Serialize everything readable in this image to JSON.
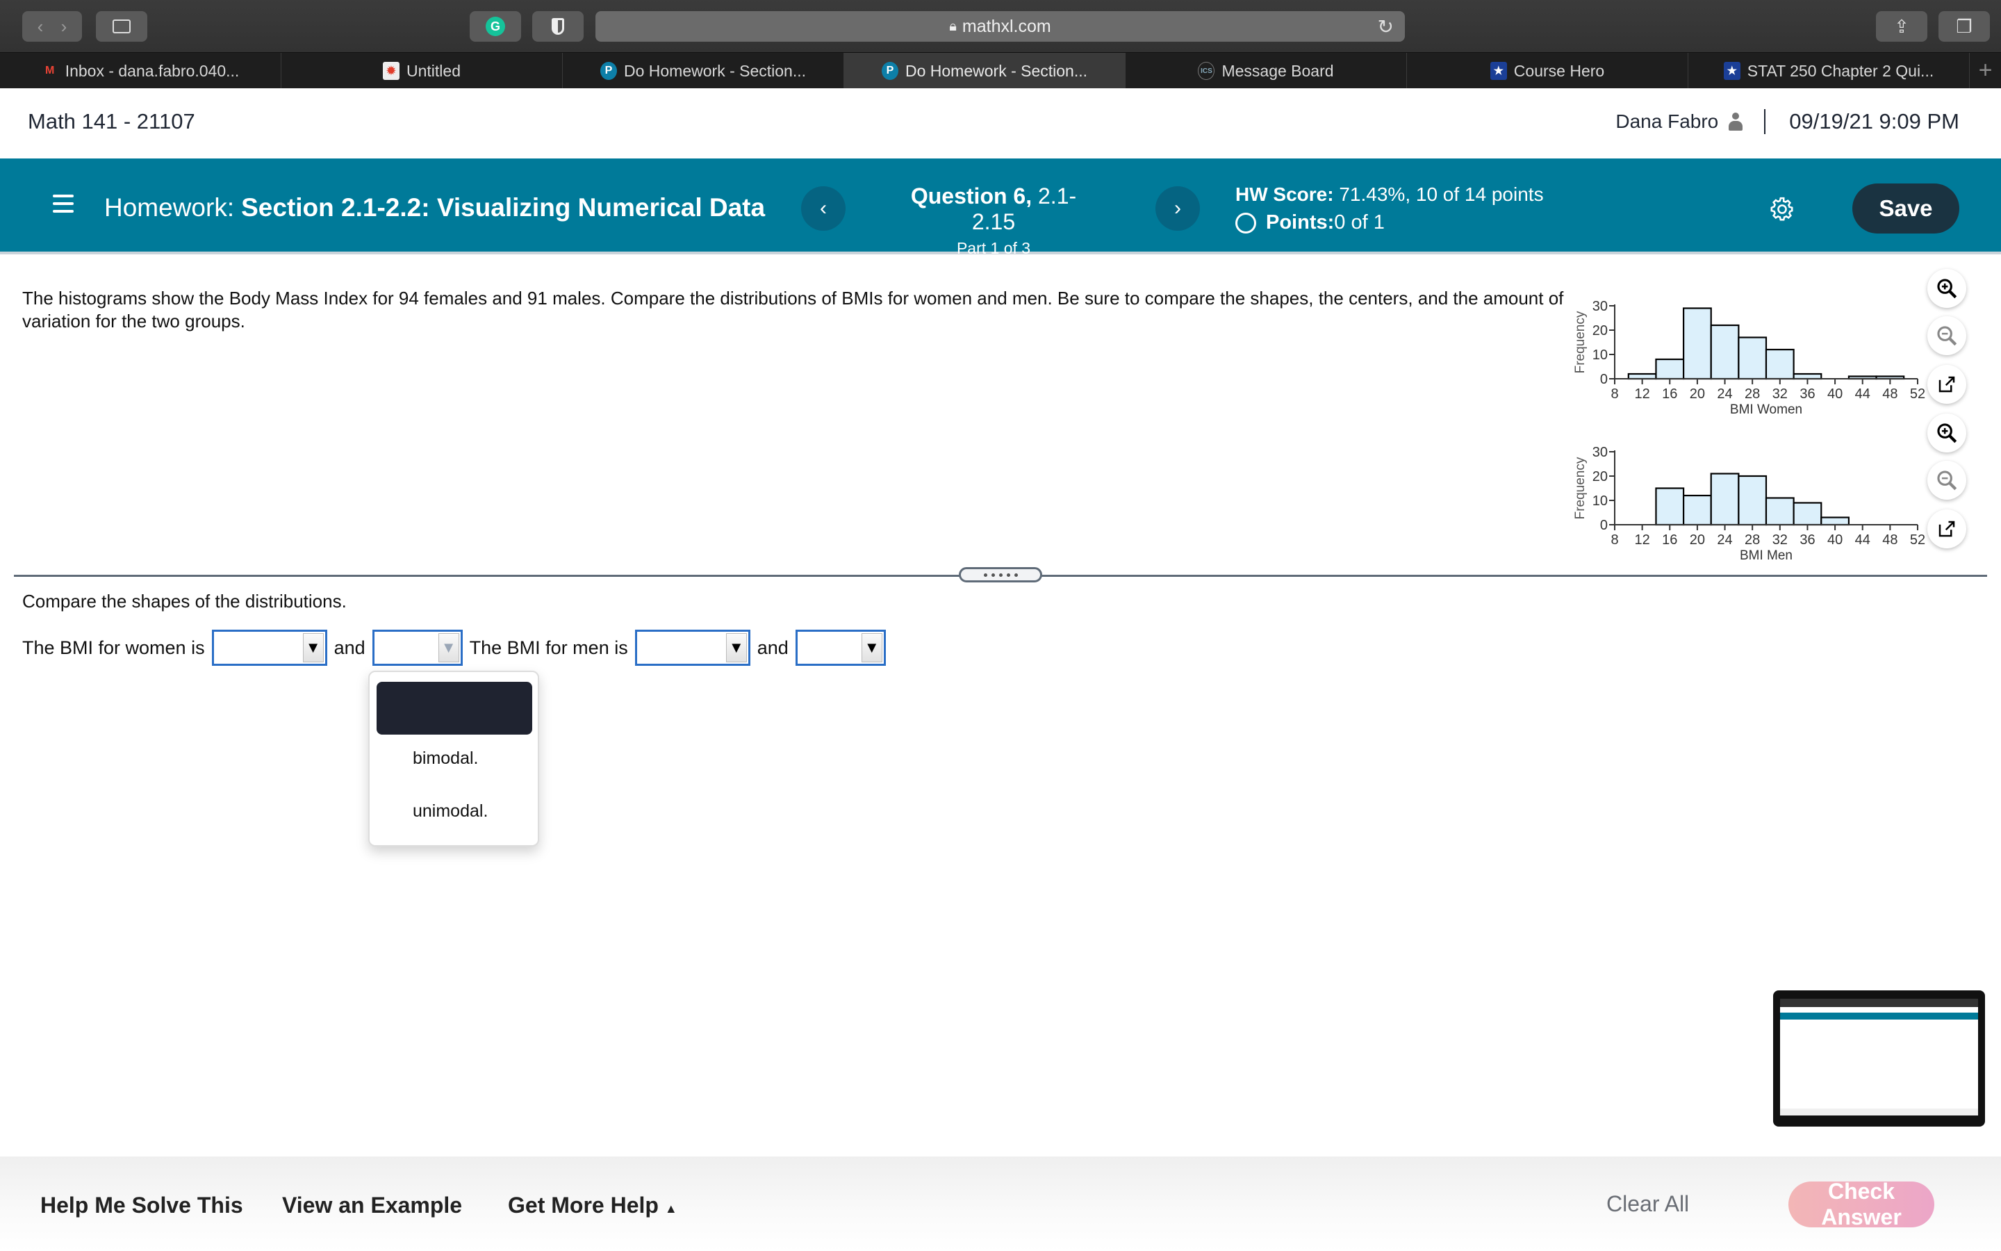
{
  "browser": {
    "url": "mathxl.com",
    "tabs": [
      {
        "label": "Inbox - dana.fabro.040...",
        "icon": "gmail-icon",
        "active": false
      },
      {
        "label": "Untitled",
        "icon": "canvas-icon",
        "active": false
      },
      {
        "label": "Do Homework - Section...",
        "icon": "pearson-icon",
        "active": false
      },
      {
        "label": "Do Homework - Section...",
        "icon": "pearson-icon",
        "active": true
      },
      {
        "label": "Message Board",
        "icon": "ics-icon",
        "active": false
      },
      {
        "label": "Course Hero",
        "icon": "coursehero-icon",
        "active": false
      },
      {
        "label": "STAT 250 Chapter 2 Qui...",
        "icon": "coursehero-icon",
        "active": false
      }
    ]
  },
  "header": {
    "course": "Math 141 - 21107",
    "user": "Dana Fabro",
    "datetime": "09/19/21 9:09 PM"
  },
  "banner": {
    "hw_prefix": "Homework:",
    "hw_title": "Section 2.1-2.2: Visualizing Numerical Data",
    "question_bold": "Question 6,",
    "question_rest": " 2.1-2.15",
    "part": "Part 1 of 3",
    "hw_score_label": "HW Score:",
    "hw_score_value": " 71.43%, 10 of 14 points",
    "points_label": "Points:",
    "points_value": " 0 of 1",
    "save_label": "Save"
  },
  "question": {
    "text": "The histograms show the Body Mass Index for 94 females and 91 males. Compare the distributions of BMIs for women and men. Be sure to compare the shapes, the centers, and the amount of variation for the two groups.",
    "sub_prompt": "Compare the shapes of the distributions.",
    "sentence": {
      "women_prefix": "The BMI for women is",
      "and1": "and",
      "men_prefix": "The BMI for men is",
      "and2": "and"
    },
    "dropdown_open": {
      "options": [
        "",
        "bimodal.",
        "unimodal."
      ],
      "highlighted_index": 0
    }
  },
  "footer": {
    "help_me_solve": "Help Me Solve This",
    "view_example": "View an Example",
    "get_more_help": "Get More Help",
    "clear_all": "Clear All",
    "check_answer": "Check Answer"
  },
  "colors": {
    "banner": "#007a99",
    "save_button": "#1a3341",
    "bar_fill": "#dcf0fb",
    "dropdown_border": "#2a6ec6"
  },
  "chart_data": [
    {
      "type": "bar",
      "title": "",
      "xlabel": "BMI Women",
      "ylabel": "Frequency",
      "bin_edges": [
        10,
        14,
        18,
        22,
        26,
        30,
        34,
        38,
        42,
        46,
        50
      ],
      "values": [
        2,
        8,
        29,
        22,
        17,
        12,
        2,
        0,
        1,
        1
      ],
      "xticks": [
        8,
        12,
        16,
        20,
        24,
        28,
        32,
        36,
        40,
        44,
        48,
        52
      ],
      "yticks": [
        0,
        10,
        20,
        30
      ],
      "xlim": [
        8,
        52
      ],
      "ylim": [
        0,
        30
      ]
    },
    {
      "type": "bar",
      "title": "",
      "xlabel": "BMI Men",
      "ylabel": "Frequency",
      "bin_edges": [
        14,
        18,
        22,
        26,
        30,
        34,
        38,
        42
      ],
      "values": [
        15,
        12,
        21,
        20,
        11,
        9,
        3
      ],
      "xticks": [
        8,
        12,
        16,
        20,
        24,
        28,
        32,
        36,
        40,
        44,
        48,
        52
      ],
      "yticks": [
        0,
        10,
        20,
        30
      ],
      "xlim": [
        8,
        52
      ],
      "ylim": [
        0,
        30
      ]
    }
  ]
}
